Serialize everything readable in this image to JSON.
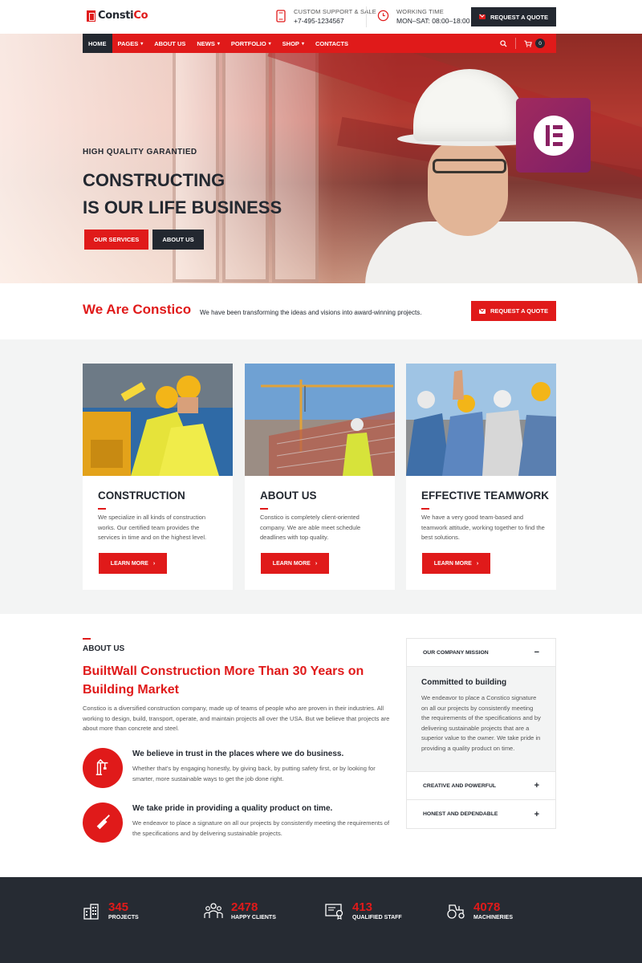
{
  "brand": {
    "name_part1": "Constі",
    "name_part2": "Co"
  },
  "topbar": {
    "support_label": "CUSTOM SUPPORT & SALE",
    "support_value": "+7-495-1234567",
    "hours_label": "WORKING TIME",
    "hours_value": "MON–SAT: 08:00–18:00",
    "quote_button": "REQUEST A QUOTE"
  },
  "nav": {
    "items": [
      {
        "label": "HOME"
      },
      {
        "label": "PAGES"
      },
      {
        "label": "ABOUT US"
      },
      {
        "label": "NEWS"
      },
      {
        "label": "PORTFOLIO"
      },
      {
        "label": "SHOP"
      },
      {
        "label": "CONTACTS"
      }
    ],
    "cart_count": "0"
  },
  "hero": {
    "subtitle": "HIGH QUALITY GARANTIED",
    "title_line1": "CONSTRUCTING",
    "title_line2": "IS OUR LIFE BUSINESS",
    "btn_services": "OUR SERVICES",
    "btn_about": "ABOUT US"
  },
  "intro": {
    "title": "We Are Constico",
    "description": "We have been transforming the ideas and visions into award-winning projects.",
    "quote_button": "REQUEST A QUOTE"
  },
  "cards": [
    {
      "title": "CONSTRUCTION",
      "text": "We specialize in all kinds of construction works. Our certified team provides the services in time and on the highest level.",
      "button": "LEARN MORE"
    },
    {
      "title": "ABOUT US",
      "text": "Constico is completely client-oriented company. We are able meet schedule deadlines with top quality.",
      "button": "LEARN MORE"
    },
    {
      "title": "EFFECTIVE TEAMWORK",
      "text": "We have a very good team-based and teamwork attitude, working together to find the best solutions.",
      "button": "LEARN MORE"
    }
  ],
  "about": {
    "label": "ABOUT US",
    "title": "BuiltWall Construction More Than 30 Years on Building Market",
    "text": "Constico is a diversified construction company, made up of teams of people who are proven in their industries. All working to design, build, transport, operate, and maintain projects all over the USA. But we believe that projects are about more than concrete and steel.",
    "features": [
      {
        "title": "We believe in trust in the places where we do business.",
        "text": "Whether that's by engaging honestly, by giving back, by putting safety first, or by looking for smarter, more sustainable ways to get the job done right."
      },
      {
        "title": "We take pride in providing a quality product on time.",
        "text": "We endeavor to place a signature on all our projects by consistently meeting the requirements of the specifications and by delivering sustainable projects."
      }
    ]
  },
  "accordion": {
    "open_title": "OUR COMPANY MISSION",
    "open_sign": "−",
    "body_title": "Committed to building",
    "body_text": "We endeavor to place a Constico signature on all our projects by consistently meeting the requirements of the specifications and by delivering sustainable projects that are a superior value to the owner. We take pride in providing a quality product on time.",
    "closed_items": [
      {
        "title": "CREATIVE AND POWERFUL",
        "sign": "+"
      },
      {
        "title": "HONEST AND DEPENDABLE",
        "sign": "+"
      }
    ]
  },
  "stats": [
    {
      "value": "345",
      "label": "PROJECTS",
      "icon": "buildings-icon"
    },
    {
      "value": "2478",
      "label": "HAPPY CLIENTS",
      "icon": "people-icon"
    },
    {
      "value": "413",
      "label": "QUALIFIED STAFF",
      "icon": "certificate-icon"
    },
    {
      "value": "4078",
      "label": "MACHINERIES",
      "icon": "tractor-icon"
    }
  ],
  "colors": {
    "accent": "#e01a1a",
    "dark": "#232830",
    "band": "#f3f4f4"
  }
}
